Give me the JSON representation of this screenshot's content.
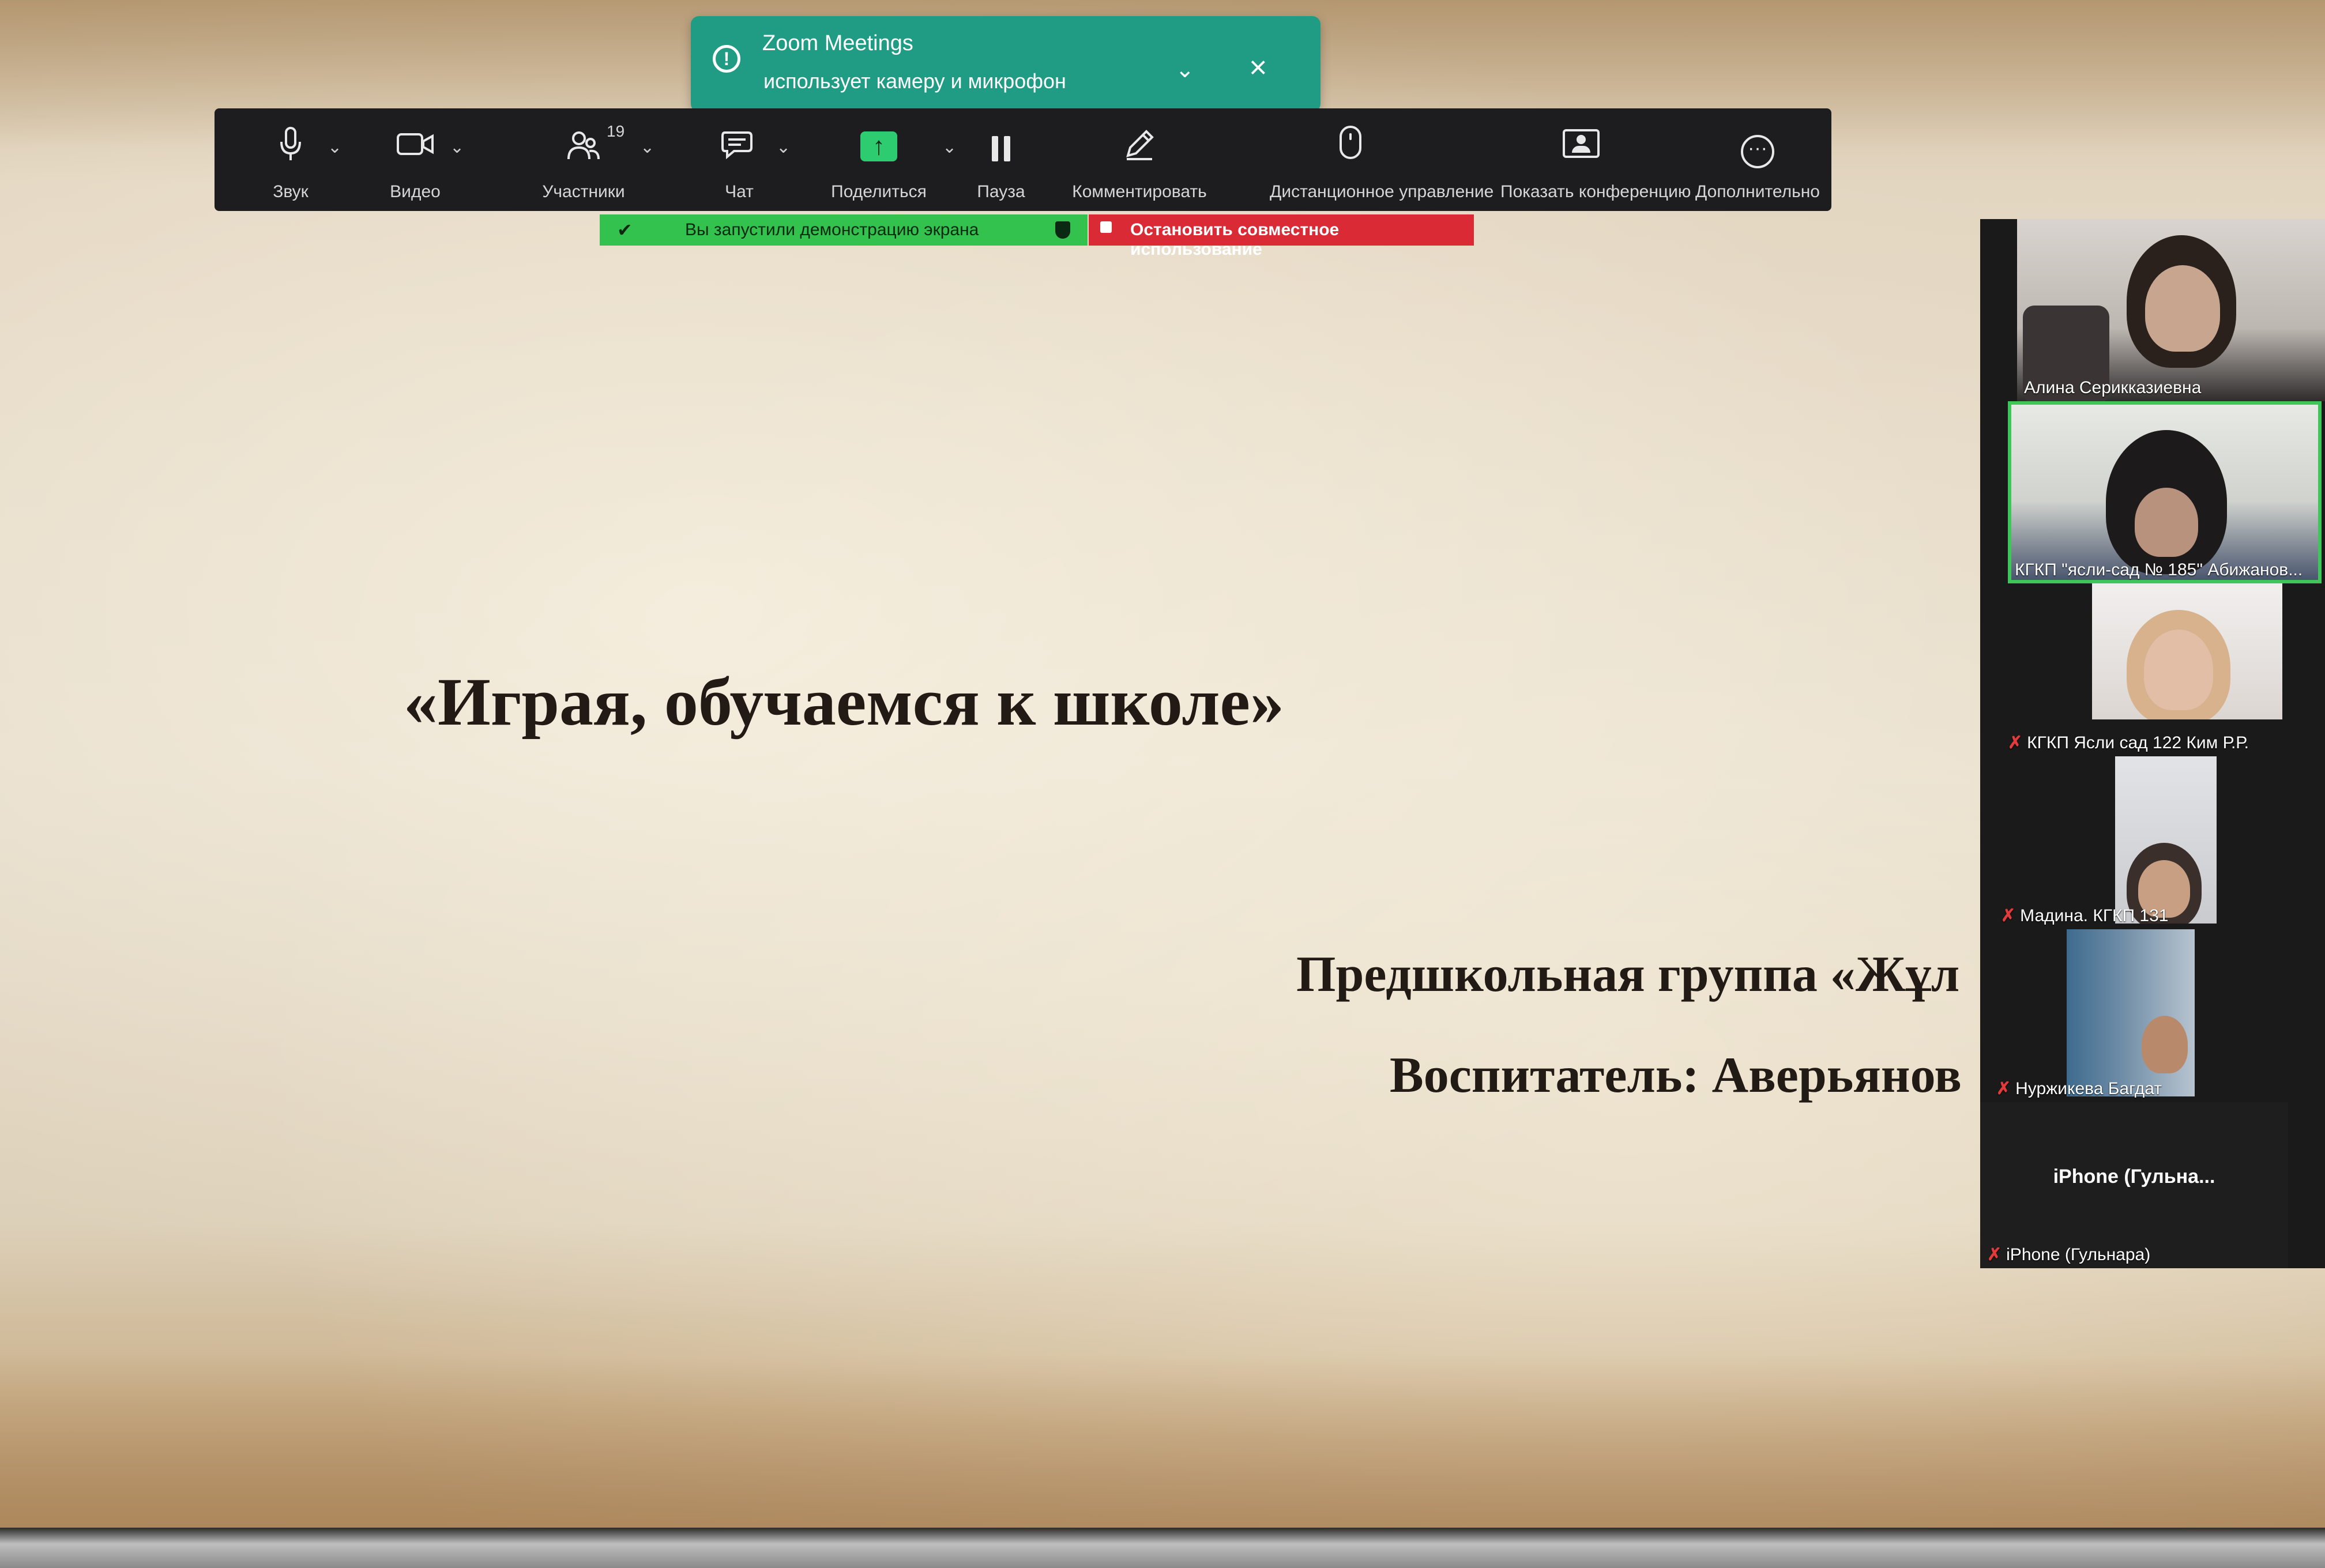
{
  "slide": {
    "title": "«Играя, обучаемся к школе»",
    "line1": "Предшкольная группа «Жұл",
    "line2": "Воспитатель: Аверьянов"
  },
  "notification": {
    "title": "Zoom Meetings",
    "text": "использует камеру и микрофон",
    "icon": "alert-circle-icon",
    "color": "#1f9c83"
  },
  "toolbar": {
    "items": [
      {
        "label": "Звук",
        "icon": "microphone-icon"
      },
      {
        "label": "Видео",
        "icon": "video-camera-icon"
      },
      {
        "label": "Участники",
        "icon": "participants-icon",
        "count": "19"
      },
      {
        "label": "Чат",
        "icon": "chat-icon"
      },
      {
        "label": "Поделиться",
        "icon": "share-screen-icon"
      },
      {
        "label": "Пауза",
        "icon": "pause-icon"
      },
      {
        "label": "Комментировать",
        "icon": "pencil-icon"
      },
      {
        "label": "Дистанционное управление",
        "icon": "mouse-icon"
      },
      {
        "label": "Показать конференцию",
        "icon": "show-meeting-icon"
      },
      {
        "label": "Дополнительно",
        "icon": "more-icon"
      }
    ]
  },
  "share_status": {
    "sharing_text": "Вы запустили демонстрацию экрана",
    "stop_text": "Остановить совместное использование",
    "sharing_color": "#33c24d",
    "stop_color": "#d92a36"
  },
  "participants": [
    {
      "name": "Алина Серикказиевна",
      "muted": false
    },
    {
      "name": "КГКП \"ясли-сад № 185\" Абижанов...",
      "muted": false,
      "active": true
    },
    {
      "name": "КГКП Ясли сад 122 Ким Р.Р.",
      "muted": true
    },
    {
      "name": "Мадина. КГКП 131",
      "muted": true
    },
    {
      "name": "Нуржикева Багдат",
      "muted": true
    },
    {
      "name": "iPhone (Гульнара)",
      "muted": true,
      "display_label": "iPhone  (Гульна..."
    }
  ]
}
